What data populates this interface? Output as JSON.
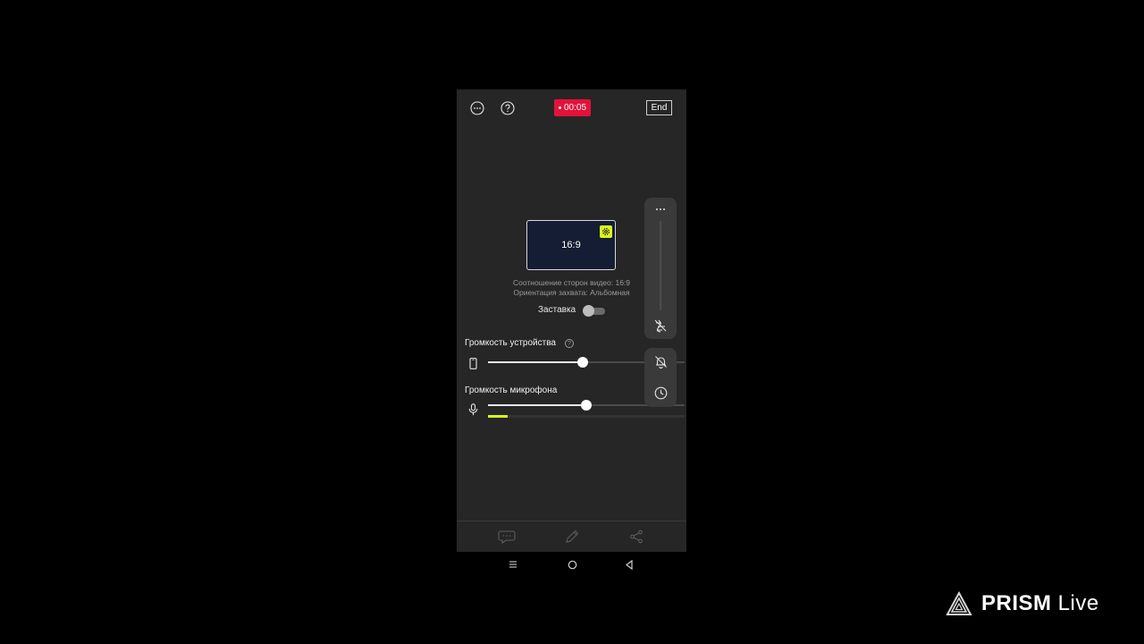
{
  "top_bar": {
    "menu_icon": "more-horizontal-icon",
    "help_icon": "question-circle-icon",
    "recording_time": "00:05",
    "end_label": "End"
  },
  "preview": {
    "ratio_label": "16:9",
    "settings_icon": "gear-icon",
    "aspect_info": "Соотношение сторон видео: 16:9",
    "orientation_info": "Ориентация захвата: Альбомная"
  },
  "screensaver": {
    "label": "Заставка",
    "enabled": false
  },
  "device_volume": {
    "label": "Громкость устройства",
    "help_icon": "question-circle-icon",
    "icon": "phone-icon",
    "value": 0.48
  },
  "mic_volume": {
    "label": "Громкость микрофона",
    "icon": "microphone-icon",
    "value": 0.5,
    "input_level": 0.1
  },
  "side_panel": {
    "more_icon": "more-horizontal-icon",
    "filter_off_icon": "filter-off-icon",
    "notifications_off_icon": "bell-off-icon",
    "timer_icon": "clock-icon"
  },
  "bottom_bar": {
    "chat_icon": "chat-icon",
    "edit_icon": "pencil-icon",
    "share_icon": "share-icon"
  },
  "nav_bar": {
    "recents_icon": "recents-icon",
    "home_icon": "home-icon",
    "back_icon": "back-icon"
  },
  "brand": {
    "name_bold": "PRISM",
    "name_light": " Live"
  },
  "colors": {
    "record_red": "#e4113b",
    "accent_lime": "#d9f51e",
    "panel_bg": "#262626"
  }
}
